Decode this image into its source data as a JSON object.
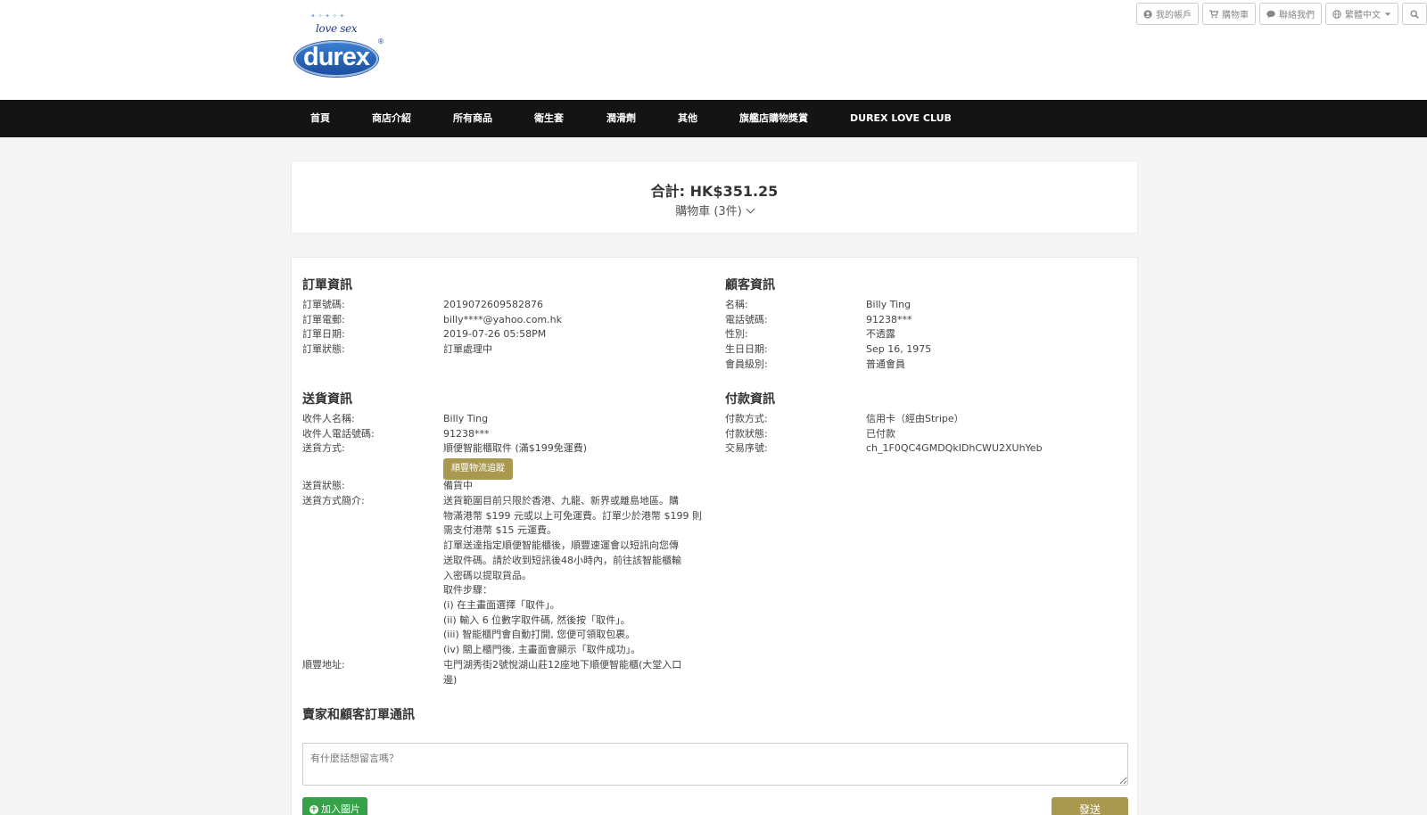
{
  "logo": {
    "tagline": "love sex",
    "brand": "durex",
    "reg": "®"
  },
  "utility": {
    "account": "我的帳戶",
    "cart": "購物車",
    "contact": "聯絡我們",
    "language": "繁體中文"
  },
  "nav": [
    "首頁",
    "商店介紹",
    "所有商品",
    "衛生套",
    "潤滑劑",
    "其他",
    "旗艦店購物獎賞",
    "DUREX LOVE CLUB"
  ],
  "summary": {
    "total": "合計: HK$351.25",
    "cart": "購物車 (3件)"
  },
  "order_info": {
    "title": "訂單資訊",
    "rows": [
      {
        "label": "訂單號碼:",
        "value": "20190726095828​76"
      },
      {
        "label": "訂單電郵:",
        "value": "billy****@yahoo.com.hk"
      },
      {
        "label": "訂單日期:",
        "value": "2019-07-26 05:58PM"
      },
      {
        "label": "訂單狀態:",
        "value": "訂單處理中"
      }
    ]
  },
  "customer_info": {
    "title": "顧客資訊",
    "rows": [
      {
        "label": "名稱:",
        "value": "Billy Ting"
      },
      {
        "label": "電話號碼:",
        "value": "91238***"
      },
      {
        "label": "性別:",
        "value": "不透露"
      },
      {
        "label": "生日日期:",
        "value": "Sep 16, 1975"
      },
      {
        "label": "會員級別:",
        "value": "普通會員"
      }
    ]
  },
  "delivery_info": {
    "title": "送貨資訊",
    "recipient_label": "收件人名稱:",
    "recipient": "Billy Ting",
    "phone_label": "收件人電話號碼:",
    "phone": "91238***",
    "method_label": "送貨方式:",
    "method": "順便智能櫃取件 (滿$199免運費)",
    "track_button": "順豐物流追蹤",
    "status_label": "送貨狀態:",
    "status": "備貨中",
    "intro_label": "送貨方式簡介:",
    "intro_lines": [
      "送貨範圍目前只限於香港、九龍、新界或離島地區。購",
      "物滿港幣 $199 元或以上可免運費。訂單少於港幣 $199 則",
      "需支付港幣 $15 元運費。",
      "訂單送達指定順便智能櫃後，順豐速運會以短訊向您傳",
      "送取件碼。請於收到短訊後48小時內，前往該智能櫃輸",
      "入密碼以提取貨品。",
      "取件步驟：",
      "(i) 在主畫面選擇「取件」。",
      "(ii) 輸入 6 位數字取件碼, 然後按「取件」。",
      "(iii) 智能櫃門會自動打開, 您便可領取包裹。",
      "(iv) 關上櫃門後, 主畫面會顯示「取件成功」。"
    ],
    "address_label": "順豐地址:",
    "address_lines": [
      "屯門湖秀街2號悅湖山莊12座地下順便智能櫃(大堂入口",
      "邊)"
    ]
  },
  "payment_info": {
    "title": "付款資訊",
    "rows": [
      {
        "label": "付款方式:",
        "value": "信用卡（經由Stripe）"
      },
      {
        "label": "付款狀態:",
        "value": "已付款"
      },
      {
        "label": "交易序號:",
        "value": "ch_1F0QC4GMDQkIDhCWU2XUhYeb"
      }
    ]
  },
  "messages": {
    "title": "賣家和顧客訂單通訊",
    "placeholder": "有什麼話想留言嗎？",
    "add_image": "加入圖片",
    "send": "發送"
  }
}
